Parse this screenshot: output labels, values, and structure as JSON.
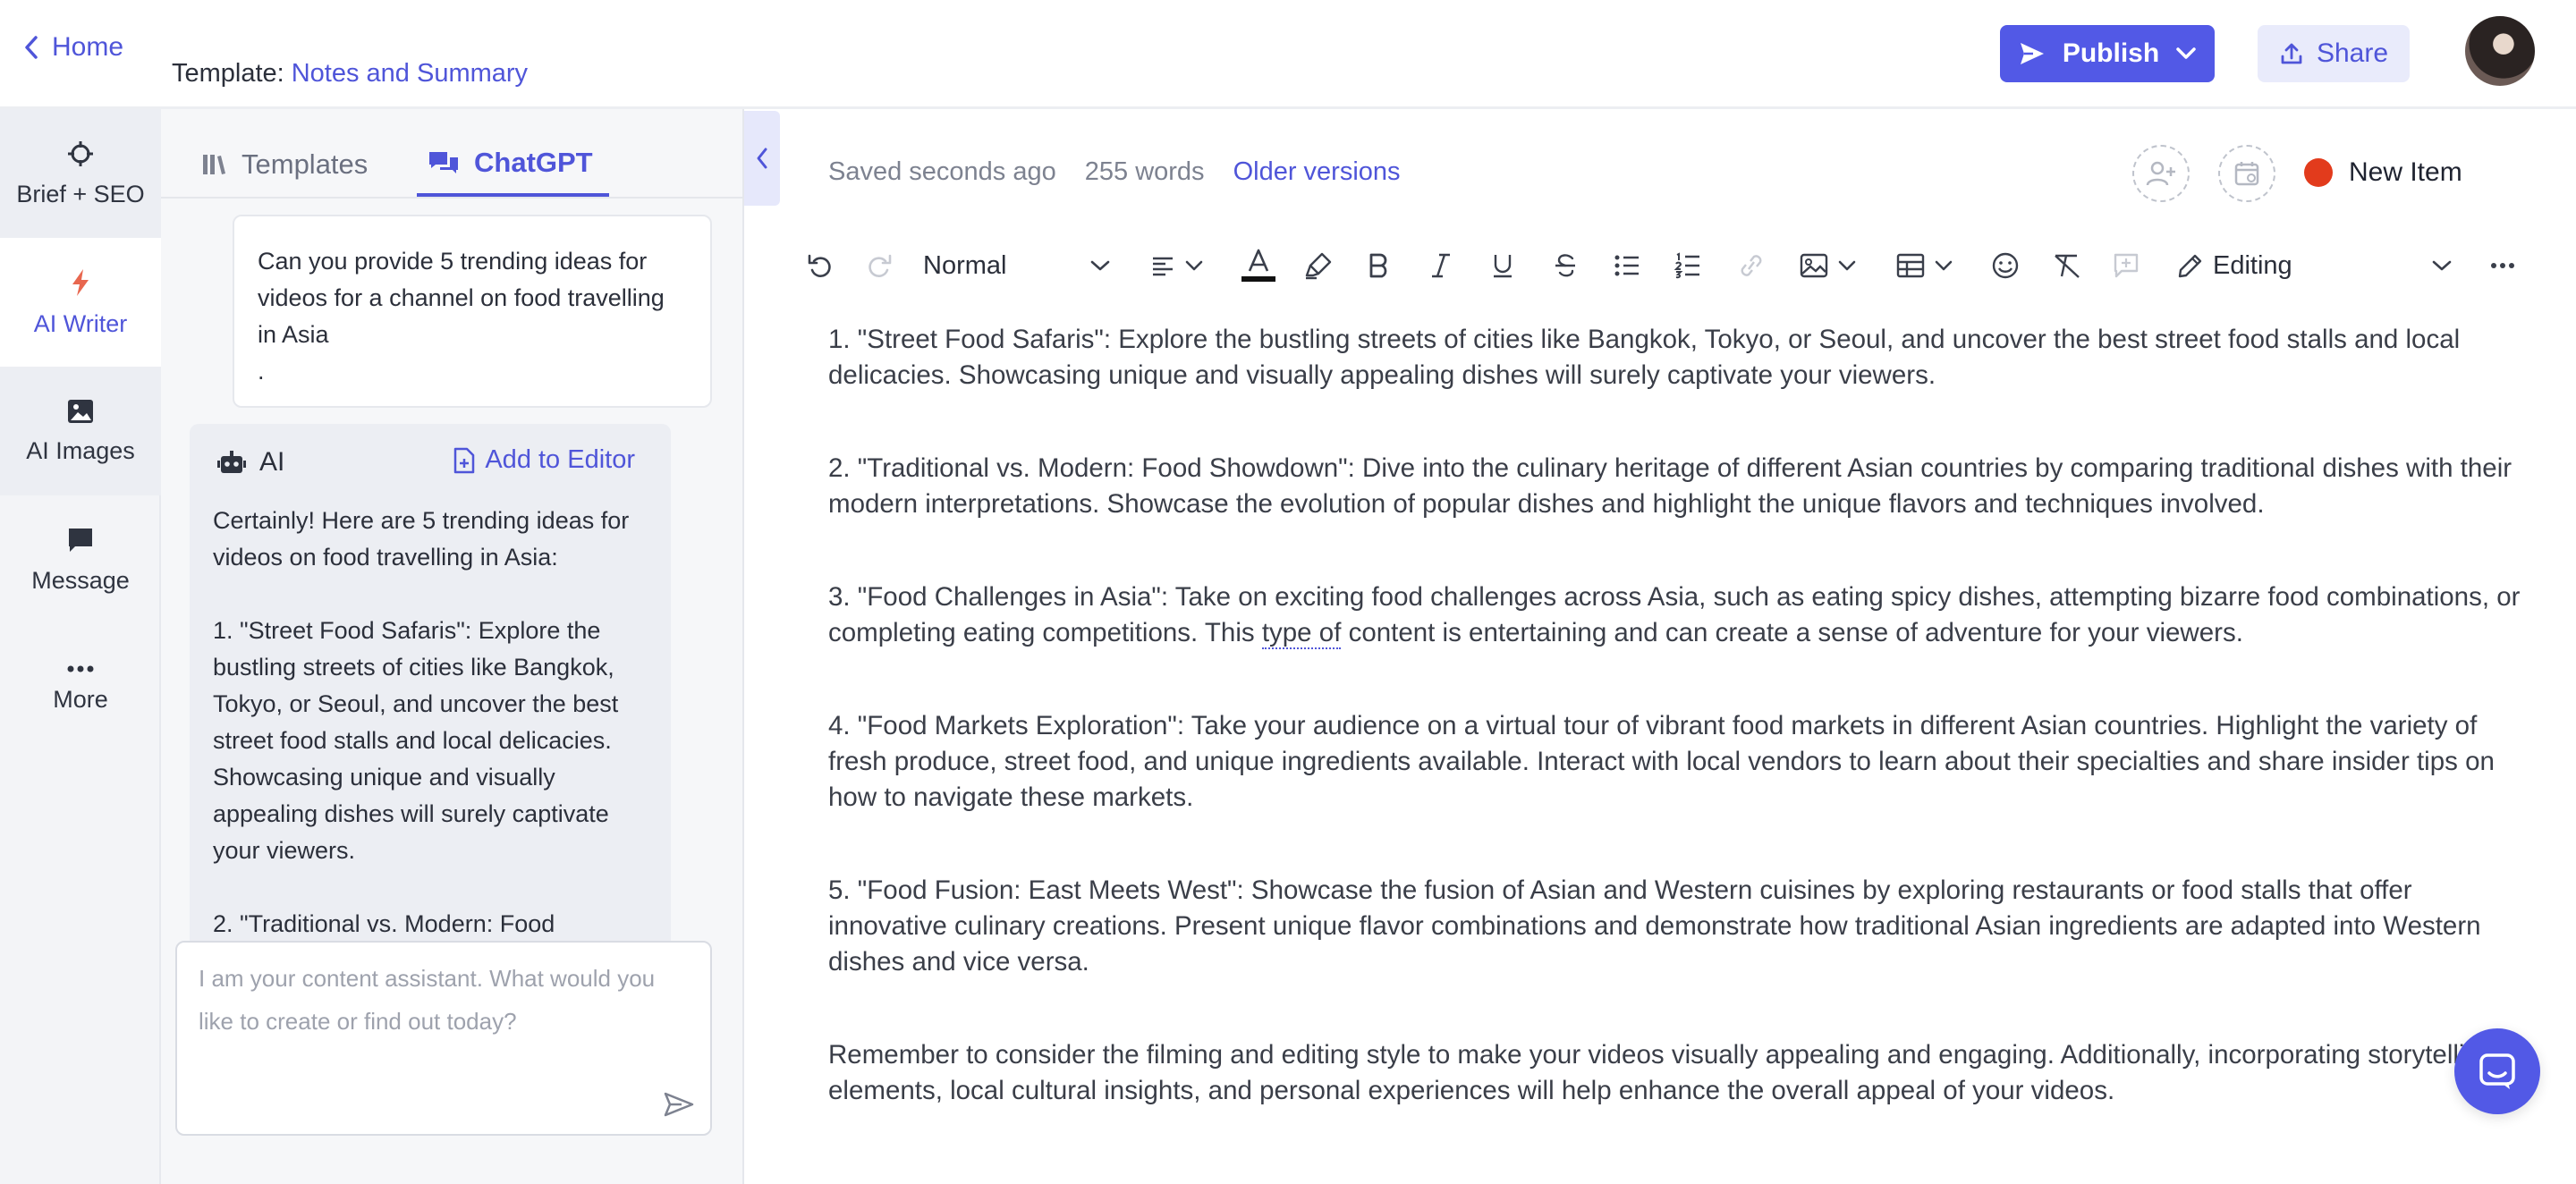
{
  "topbar": {
    "home_label": "Home",
    "template_prefix": "Template:",
    "template_name": "Notes and Summary",
    "publish_label": "Publish",
    "share_label": "Share"
  },
  "rail": {
    "items": [
      {
        "label": "Brief + SEO",
        "icon": "crosshair-icon"
      },
      {
        "label": "AI Writer",
        "icon": "lightning-icon"
      },
      {
        "label": "AI Images",
        "icon": "image-icon"
      },
      {
        "label": "Message",
        "icon": "message-icon"
      },
      {
        "label": "More",
        "icon": "more-icon"
      }
    ]
  },
  "panel": {
    "tabs": [
      {
        "label": "Templates",
        "icon": "library-icon"
      },
      {
        "label": "ChatGPT",
        "icon": "chat-icon"
      }
    ],
    "user_message": "Can you provide 5 trending ideas for videos for a channel on food travelling in Asia\n.",
    "ai_label": "AI",
    "add_to_editor": "Add to Editor",
    "ai_response": "Certainly! Here are 5 trending ideas for videos on food travelling in Asia:\n\n1. \"Street Food Safaris\": Explore the bustling streets of cities like Bangkok, Tokyo, or Seoul, and uncover the best street food stalls and local delicacies. Showcasing unique and visually appealing dishes will surely captivate your viewers.\n\n2. \"Traditional vs. Modern: Food",
    "input_placeholder": "I am your content assistant. What would you like to create or find out today?"
  },
  "editor": {
    "saved_status": "Saved seconds ago",
    "word_count": "255 words",
    "older_versions": "Older versions",
    "new_item_label": "New Item",
    "status_dot_color": "#e23b1c",
    "style_select": "Normal",
    "editing_mode": "Editing",
    "paragraphs": [
      "1. \"Street Food Safaris\": Explore the bustling streets of cities like Bangkok, Tokyo, or Seoul, and uncover the best street food stalls and local delicacies. Showcasing unique and visually appealing dishes will surely captivate your viewers.",
      "2. \"Traditional vs. Modern: Food Showdown\": Dive into the culinary heritage of different Asian countries by comparing traditional dishes with their modern interpretations. Showcase the evolution of popular dishes and highlight the unique flavors and techniques involved.",
      "4. \"Food Markets Exploration\": Take your audience on a virtual tour of vibrant food markets in different Asian countries. Highlight the variety of fresh produce, street food, and unique ingredients available. Interact with local vendors to learn about their specialties and share insider tips on how to navigate these markets.",
      "5. \"Food Fusion: East Meets West\": Showcase the fusion of Asian and Western cuisines by exploring restaurants or food stalls that offer innovative culinary creations. Present unique flavor combinations and demonstrate how traditional Asian ingredients are adapted into Western dishes and vice versa.",
      "Remember to consider the filming and editing style to make your videos visually appealing and engaging. Additionally, incorporating storytelling elements, local cultural insights, and personal experiences will help enhance the overall appeal of your videos."
    ],
    "p3_before": "3. \"Food Challenges in Asia\": Take on exciting food challenges across Asia, such as eating spicy dishes, attempting bizarre food combinations, or completing eating competitions. This ",
    "p3_spell": "type of",
    "p3_after": " content is entertaining and can create a sense of adventure for your viewers."
  },
  "colors": {
    "accent": "#5259e6",
    "link": "#4f55d9"
  }
}
